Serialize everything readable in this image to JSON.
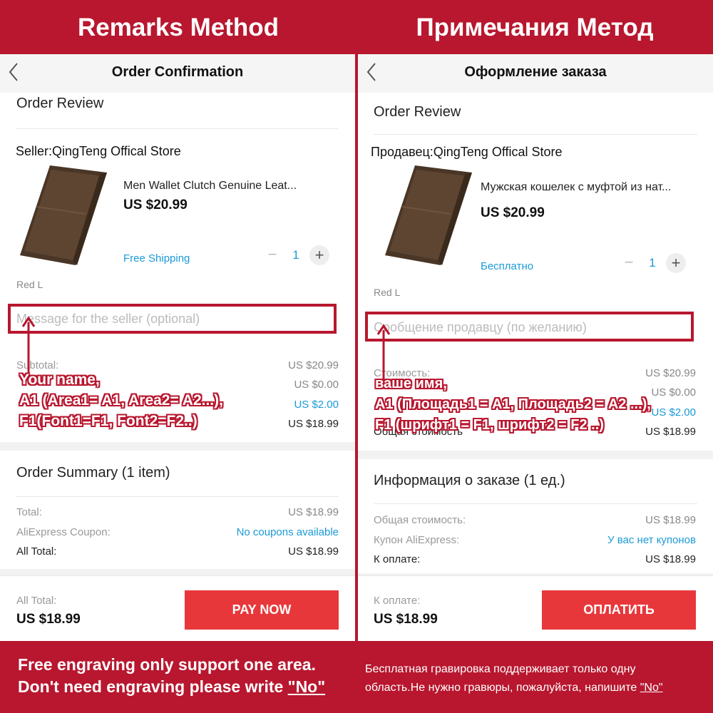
{
  "banner": {
    "left_title": "Remarks Method",
    "right_title": "Примечания Метод"
  },
  "footer": {
    "left_line1": "Free engraving only support one area.",
    "left_line2_prefix": "Don't need engraving please write ",
    "left_line2_quote": "\"No\"",
    "right_line1": "Бесплатная гравировка поддерживает только одну",
    "right_line2_prefix": "область.Не нужно гравюры, пожалуйста, напишите ",
    "right_line2_quote": "\"No\""
  },
  "left": {
    "nav_title": "Order Confirmation",
    "order_review": "Order Review",
    "seller": "Seller:QingTeng Offical Store",
    "product_name": "Men Wallet Clutch Genuine Leat...",
    "price": "US $20.99",
    "shipping": "Free Shipping",
    "quantity": "1",
    "variant": "Red L",
    "message_placeholder": "Message for the seller (optional)",
    "subtotal_label": "Subtotal:",
    "subtotal_value": "US $20.99",
    "row2_value": "US $0.00",
    "row3_value": "US $2.00",
    "row4_value": "US $18.99",
    "annotation": [
      "Your name,",
      "A1 (Area1= A1, Area2= A2...),",
      "F1(Font1=F1, Font2=F2..)"
    ],
    "summary_title": "Order Summary (1 item)",
    "total_label": "Total:",
    "total_value": "US $18.99",
    "coupon_label": "AliExpress Coupon:",
    "coupon_value": "No coupons available",
    "all_total_label": "All Total:",
    "all_total_value": "US $18.99",
    "bar_label": "All Total:",
    "bar_value": "US $18.99",
    "pay_button": "PAY NOW"
  },
  "right": {
    "nav_title": "Оформление заказа",
    "order_review": "Order Review",
    "seller": "Продавец:QingTeng Offical Store",
    "product_name": "Мужская кошелек с муфтой из нат...",
    "price": "US $20.99",
    "shipping": "Бесплатно",
    "quantity": "1",
    "variant": "Red L",
    "message_placeholder": "Сообщение продавцу (по желанию)",
    "subtotal_label": "Стоимость:",
    "subtotal_value": "US $20.99",
    "row2_value": "US $0.00",
    "row3_value": "US $2.00",
    "row4_label": "Общая стоимость",
    "row4_value": "US $18.99",
    "annotation": [
      "ваше имя,",
      "A1 (Площадь1 = A1, Площадь2 = A2 ...),",
      "F1 (шрифт1 = F1, шрифт2 = F2 ..)"
    ],
    "summary_title": "Информация о заказе (1 ед.)",
    "total_label": "Общая стоимость:",
    "total_value": "US $18.99",
    "coupon_label": "Купон AliExpress:",
    "coupon_value": "У вас нет купонов",
    "all_total_label": "К оплате:",
    "all_total_value": "US $18.99",
    "bar_label": "К оплате:",
    "bar_value": "US $18.99",
    "pay_button": "ОПЛАТИТЬ"
  },
  "icons": {
    "back": "back-chevron-icon",
    "arrow": "up-arrow-icon",
    "wallet": "wallet-product-image"
  },
  "colors": {
    "brand_red": "#b8172f",
    "pay_red": "#e8373a",
    "link_blue": "#1a9ad6"
  }
}
